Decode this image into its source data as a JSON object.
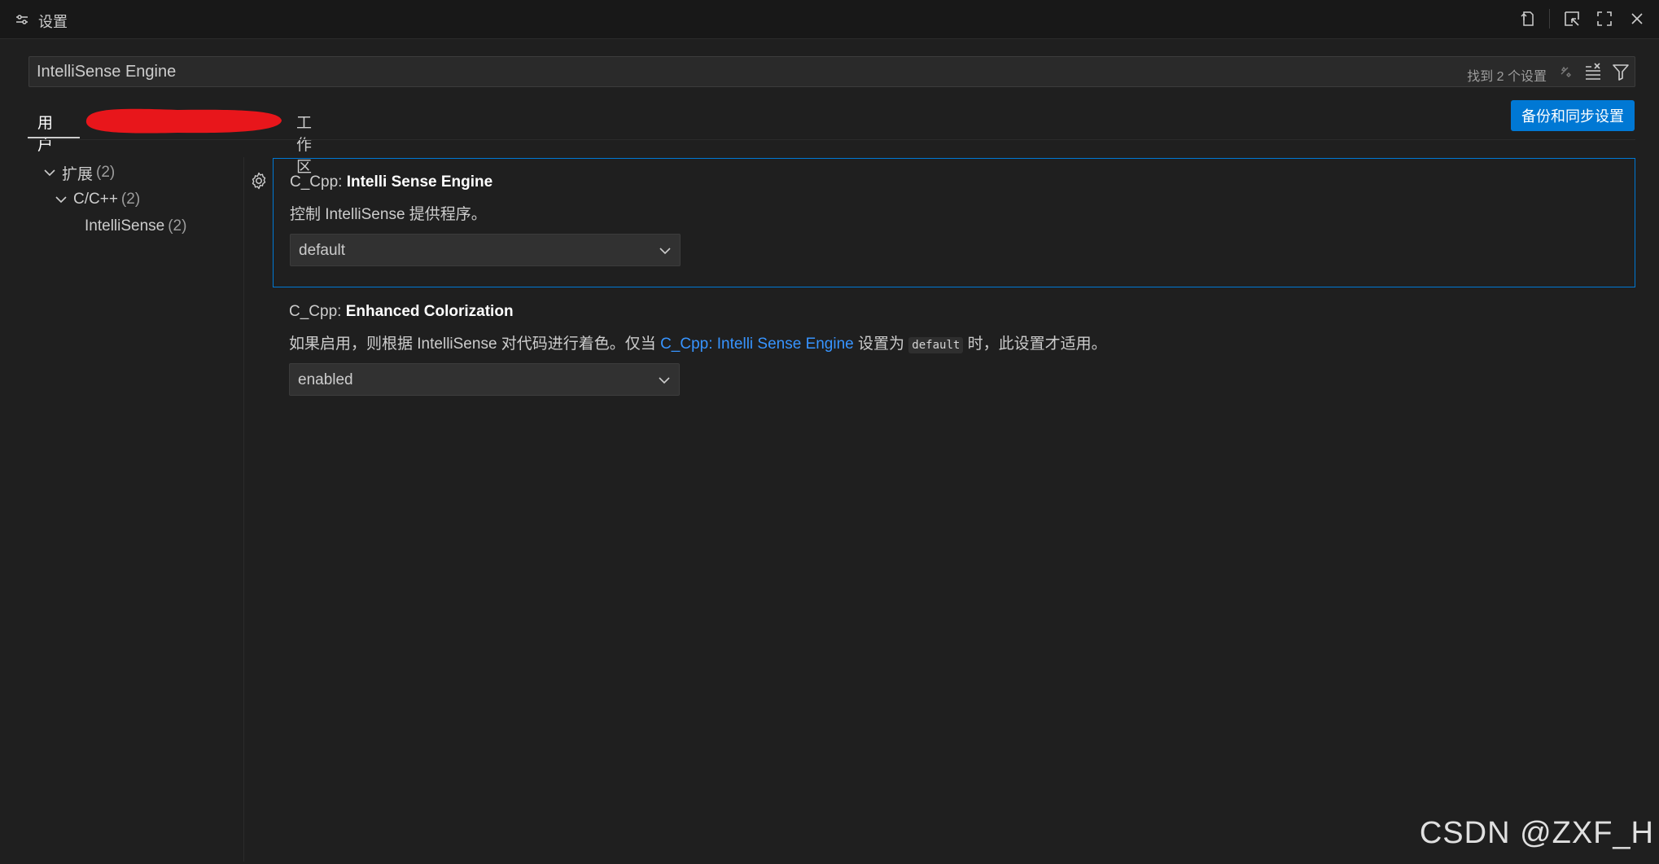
{
  "window": {
    "title": "设置"
  },
  "search": {
    "value": "IntelliSense Engine",
    "result_count": "找到 2 个设置"
  },
  "tabs": {
    "user": "用户",
    "workspace": "工作区",
    "sync_button": "备份和同步设置"
  },
  "toc": {
    "items": [
      {
        "label": "扩展",
        "count": "(2)"
      },
      {
        "label": "C/C++",
        "count": "(2)"
      },
      {
        "label": "IntelliSense",
        "count": "(2)"
      }
    ]
  },
  "settings": [
    {
      "category": "C_Cpp: ",
      "name": "Intelli Sense Engine",
      "description": "控制 IntelliSense 提供程序。",
      "value": "default"
    },
    {
      "category": "C_Cpp: ",
      "name": "Enhanced Colorization",
      "description_before": "如果启用，则根据 IntelliSense 对代码进行着色。仅当 ",
      "description_link": "C_Cpp: Intelli Sense Engine",
      "description_mid": " 设置为 ",
      "description_code": "default",
      "description_after": " 时，此设置才适用。",
      "value": "enabled"
    }
  ],
  "watermark": "CSDN @ZXF_H",
  "colors": {
    "accent": "#0078d4",
    "link": "#3794ff",
    "background": "#1f1f1f",
    "redaction": "#e8161b"
  }
}
